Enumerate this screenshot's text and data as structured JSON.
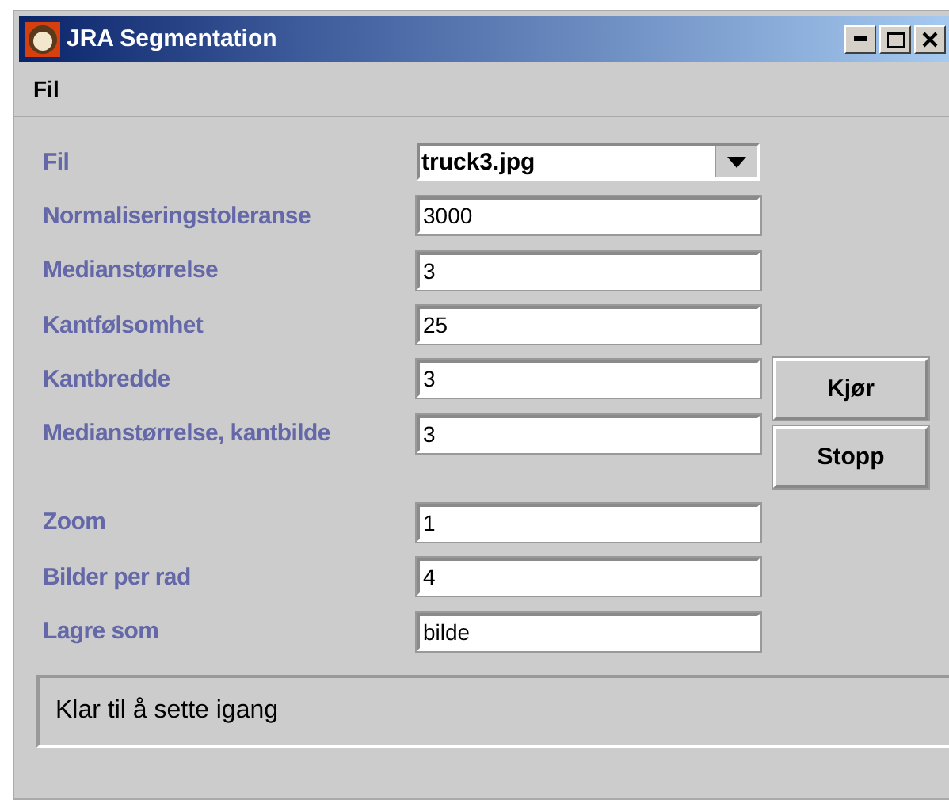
{
  "window": {
    "title": "JRA Segmentation"
  },
  "menu": [
    {
      "label": "Fil"
    }
  ],
  "sections": [
    {
      "fields": [
        {
          "kind": "select",
          "label": "Fil",
          "value": "truck3.jpg"
        },
        {
          "kind": "text",
          "label": "Normaliseringstoleranse",
          "value": "3000"
        },
        {
          "kind": "text",
          "label": "Medianstørrelse",
          "value": "3"
        },
        {
          "kind": "text",
          "label": "Kantfølsomhet",
          "value": "25"
        },
        {
          "kind": "text",
          "label": "Kantbredde",
          "value": "3"
        },
        {
          "kind": "text",
          "label": "Medianstørrelse, kantbilde",
          "value": "3"
        }
      ]
    },
    {
      "fields": [
        {
          "kind": "text",
          "label": "Zoom",
          "value": "1"
        },
        {
          "kind": "text",
          "label": "Bilder per rad",
          "value": "4"
        },
        {
          "kind": "text",
          "label": "Lagre som",
          "value": "bilde"
        }
      ]
    }
  ],
  "buttons": [
    {
      "label": "Kjør"
    },
    {
      "label": "Stopp"
    }
  ],
  "status_bar": "Klar til å sette igang"
}
